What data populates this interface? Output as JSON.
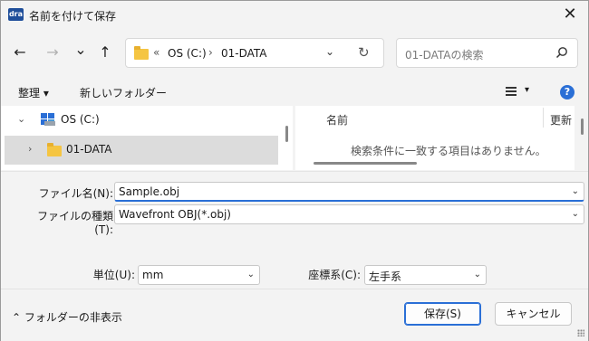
{
  "window": {
    "app_icon": "dra",
    "title": "名前を付けて保存",
    "close_glyph": "✕"
  },
  "nav": {
    "back_glyph": "←",
    "forward_glyph": "→",
    "recent_glyph": "⌄",
    "up_glyph": "↑"
  },
  "address": {
    "overflow": "«",
    "parts": [
      "OS (C:)",
      "01-DATA"
    ],
    "separator": "›",
    "dropdown_glyph": "⌄",
    "refresh_glyph": "↻"
  },
  "search": {
    "placeholder": "01-DATAの検索"
  },
  "toolbar": {
    "organize": "整理 ▾",
    "new_folder": "新しいフォルダー",
    "view_caret": "▾",
    "help": "?"
  },
  "tree": {
    "items": [
      {
        "label": "OS (C:)",
        "arrow": "⌄",
        "icon": "drive-icon"
      },
      {
        "label": "01-DATA",
        "arrow": "›",
        "icon": "folder-icon"
      }
    ]
  },
  "file_list": {
    "columns": [
      "名前",
      "更新"
    ],
    "empty_message": "検索条件に一致する項目はありません。"
  },
  "form": {
    "filename_label": "ファイル名(N):",
    "filename_value": "Sample.obj",
    "filetype_label": "ファイルの種類(T):",
    "filetype_value": "Wavefront OBJ(*.obj)",
    "unit_label": "単位(U):",
    "unit_value": "mm",
    "coord_label": "座標系(C):",
    "coord_value": "左手系"
  },
  "footer": {
    "hide_folders": "フォルダーの非表示",
    "hide_glyph": "⌃",
    "save": "保存(S)",
    "cancel": "キャンセル"
  },
  "colors": {
    "accent": "#2a6fd6",
    "folder": "#f5c542",
    "selected_row": "#dcdcdc"
  }
}
